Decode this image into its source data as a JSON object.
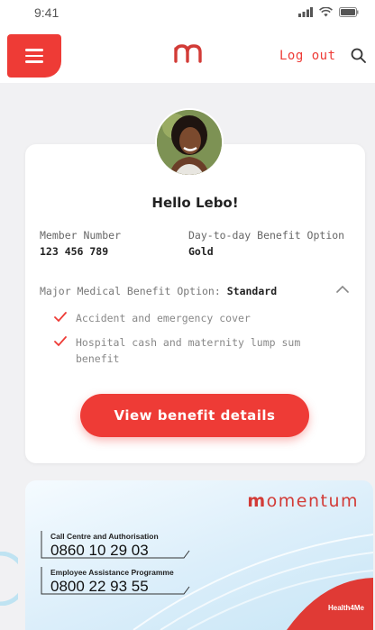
{
  "status_bar": {
    "time": "9:41",
    "signal_icon": "signal-icon",
    "wifi_icon": "wifi-icon",
    "battery_icon": "battery-icon"
  },
  "header": {
    "menu_icon": "hamburger-icon",
    "logo_icon": "momentum-m-logo",
    "logout_label": "Log out",
    "search_icon": "search-icon"
  },
  "profile": {
    "greeting": "Hello Lebo!",
    "member_number_label": "Member Number",
    "member_number": "123 456 789",
    "day_to_day_label": "Day-to-day Benefit Option",
    "day_to_day_value": "Gold",
    "major_medical_label": "Major Medical Benefit Option:",
    "major_medical_value": "Standard",
    "benefits": [
      "Accident and emergency cover",
      "Hospital cash and maternity lump sum",
      "benefit"
    ],
    "cta_label": "View benefit details"
  },
  "member_card": {
    "brand_m": "m",
    "brand_rest": "omentum",
    "call_centre_label": "Call Centre and Authorisation",
    "call_centre_number": "0860 10 29 03",
    "eap_label": "Employee Assistance Programme",
    "eap_number": "0800 22 93 55",
    "tagline": "Health4Me"
  },
  "colors": {
    "accent": "#ee3b36",
    "card_bg": "#ffffff",
    "page_bg": "#f1f1f3",
    "member_card_blue": "#dbeefa"
  }
}
